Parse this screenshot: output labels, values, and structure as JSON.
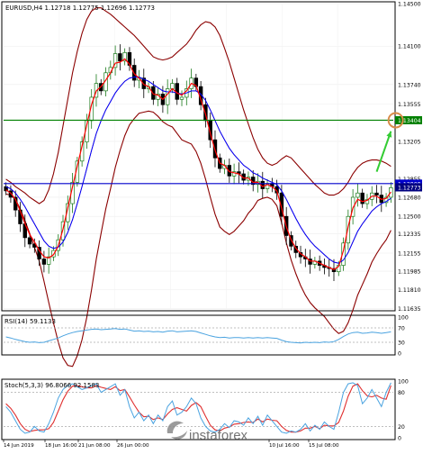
{
  "header": {
    "title": "EURUSD,H4  1.12718 1.12775 1.12696 1.12773"
  },
  "colors": {
    "background": "#ffffff",
    "candle_up": "#1a7a1a",
    "candle_down": "#000000",
    "bollinger": "#8b0000",
    "ma_fast": "#ff0000",
    "ma_slow": "#0000ff",
    "green_line": "#008000",
    "blue_line": "#0000cc",
    "arrow": "#33cc33",
    "target_circle": "#d98c4a",
    "rsi_line": "#4aa3e0",
    "stoch_main": "#4aa3e0",
    "stoch_signal": "#e03030",
    "dotted_level": "#aaaaaa",
    "watermark_text": "#666666"
  },
  "chart_data": [
    {
      "type": "candlestick",
      "symbol": "EURUSD",
      "timeframe": "H4",
      "title": "EURUSD,H4  1.12718 1.12775 1.12696 1.12773",
      "ylim": [
        1.1163,
        1.145
      ],
      "y_ticks": [
        "1.14500",
        "1.14100",
        "1.13740",
        "1.13555",
        "1.13205",
        "1.12855",
        "1.12680",
        "1.12500",
        "1.12335",
        "1.12155",
        "1.11985",
        "1.11810",
        "1.11635"
      ],
      "x_ticks": [
        "14 Jun 2019",
        "18 Jun 16:00",
        "21 Jun 08:00",
        "26 Jun 00:00",
        "10 Jul 16:00",
        "15 Jul 08:00"
      ],
      "horizontal_lines": [
        {
          "price": 1.13404,
          "label": "1.13404",
          "color": "#008000"
        },
        {
          "price": 1.12808,
          "label": "1.12808",
          "color": "#0000cc"
        }
      ],
      "current_price_label": "1.12773",
      "target": {
        "bar": 82,
        "price": 1.13404
      },
      "arrow": {
        "from_bar": 78,
        "from_price": 1.1292,
        "to_bar": 81,
        "to_price": 1.133
      },
      "close": [
        1.1274,
        1.1268,
        1.1256,
        1.1243,
        1.123,
        1.1224,
        1.1221,
        1.121,
        1.1205,
        1.1212,
        1.1218,
        1.1228,
        1.1245,
        1.1262,
        1.1282,
        1.1302,
        1.132,
        1.134,
        1.1362,
        1.1375,
        1.1368,
        1.1385,
        1.139,
        1.1403,
        1.1396,
        1.1404,
        1.1392,
        1.1378,
        1.138,
        1.137,
        1.1372,
        1.136,
        1.1365,
        1.1355,
        1.137,
        1.1375,
        1.136,
        1.1362,
        1.137,
        1.138,
        1.1372,
        1.1355,
        1.134,
        1.1322,
        1.1305,
        1.1295,
        1.1298,
        1.1288,
        1.1292,
        1.129,
        1.1284,
        1.1287,
        1.128,
        1.1283,
        1.1276,
        1.1281,
        1.1278,
        1.1272,
        1.125,
        1.1232,
        1.1222,
        1.1216,
        1.1212,
        1.121,
        1.1205,
        1.1208,
        1.1204,
        1.1202,
        1.1201,
        1.1198,
        1.1204,
        1.1225,
        1.125,
        1.1268,
        1.1272,
        1.1262,
        1.1266,
        1.1272,
        1.127,
        1.1263,
        1.1268,
        1.1277
      ],
      "bollinger_upper": [
        1.1285,
        1.1282,
        1.1278,
        1.1275,
        1.1272,
        1.1268,
        1.1265,
        1.1262,
        1.1265,
        1.1275,
        1.129,
        1.131,
        1.1335,
        1.136,
        1.1385,
        1.1405,
        1.1422,
        1.1435,
        1.1443,
        1.1446,
        1.1446,
        1.1443,
        1.144,
        1.1436,
        1.1432,
        1.1428,
        1.1424,
        1.142,
        1.1415,
        1.141,
        1.1405,
        1.14,
        1.1398,
        1.1397,
        1.1398,
        1.14,
        1.1404,
        1.1408,
        1.1412,
        1.1418,
        1.1425,
        1.143,
        1.1433,
        1.1432,
        1.1428,
        1.142,
        1.1408,
        1.1395,
        1.138,
        1.1365,
        1.135,
        1.1337,
        1.1324,
        1.1313,
        1.1305,
        1.13,
        1.1298,
        1.13,
        1.1304,
        1.1307,
        1.1305,
        1.13,
        1.1295,
        1.129,
        1.1285,
        1.128,
        1.1276,
        1.1272,
        1.127,
        1.127,
        1.1272,
        1.1276,
        1.1282,
        1.129,
        1.1296,
        1.13,
        1.1302,
        1.1303,
        1.1303,
        1.1302,
        1.13,
        1.1297
      ],
      "ma_fast": [
        1.1275,
        1.1272,
        1.1266,
        1.1255,
        1.1243,
        1.1233,
        1.1226,
        1.1218,
        1.1212,
        1.1211,
        1.1214,
        1.1222,
        1.1238,
        1.1258,
        1.1278,
        1.1297,
        1.1316,
        1.1336,
        1.1355,
        1.1368,
        1.1372,
        1.1378,
        1.1385,
        1.1394,
        1.1395,
        1.1398,
        1.1393,
        1.1384,
        1.138,
        1.1374,
        1.1372,
        1.1365,
        1.1364,
        1.136,
        1.1365,
        1.137,
        1.1366,
        1.1364,
        1.1368,
        1.1375,
        1.1373,
        1.136,
        1.1346,
        1.1328,
        1.1312,
        1.13,
        1.1298,
        1.1292,
        1.1291,
        1.129,
        1.1286,
        1.1286,
        1.1282,
        1.1282,
        1.1278,
        1.128,
        1.1278,
        1.1274,
        1.1258,
        1.124,
        1.1228,
        1.122,
        1.1215,
        1.1212,
        1.1208,
        1.1208,
        1.1206,
        1.1204,
        1.1202,
        1.12,
        1.1203,
        1.1218,
        1.124,
        1.1258,
        1.1266,
        1.1264,
        1.1265,
        1.1269,
        1.1269,
        1.1266,
        1.1267,
        1.1273
      ],
      "ma_slow": [
        1.1278,
        1.1276,
        1.1272,
        1.1266,
        1.1259,
        1.1251,
        1.1243,
        1.1235,
        1.1227,
        1.1222,
        1.122,
        1.1221,
        1.1226,
        1.1235,
        1.1247,
        1.1262,
        1.1278,
        1.1295,
        1.1312,
        1.1328,
        1.134,
        1.135,
        1.1358,
        1.1366,
        1.1372,
        1.1377,
        1.138,
        1.1381,
        1.1381,
        1.1379,
        1.1377,
        1.1374,
        1.1371,
        1.1368,
        1.1367,
        1.1367,
        1.1366,
        1.1365,
        1.1366,
        1.1368,
        1.1368,
        1.1365,
        1.1359,
        1.135,
        1.134,
        1.133,
        1.1322,
        1.1314,
        1.1308,
        1.1303,
        1.1298,
        1.1295,
        1.1291,
        1.1289,
        1.1286,
        1.1284,
        1.1282,
        1.128,
        1.1274,
        1.1266,
        1.1257,
        1.1248,
        1.124,
        1.1233,
        1.1227,
        1.1222,
        1.1218,
        1.1214,
        1.121,
        1.1207,
        1.1206,
        1.1209,
        1.1216,
        1.1226,
        1.1236,
        1.1243,
        1.1249,
        1.1255,
        1.1259,
        1.1262,
        1.1264,
        1.1267
      ]
    },
    {
      "type": "line",
      "name": "RSI(14) 59.1133",
      "title": "RSI(14) 59.1133",
      "ylim": [
        0,
        100
      ],
      "y_ticks": [
        "100",
        "70",
        "30",
        "0"
      ],
      "levels": [
        70,
        30
      ],
      "values": [
        45,
        42,
        38,
        35,
        32,
        30,
        31,
        29,
        30,
        34,
        38,
        42,
        48,
        53,
        57,
        60,
        62,
        64,
        66,
        67,
        65,
        66,
        67,
        68,
        66,
        67,
        64,
        61,
        62,
        60,
        61,
        59,
        60,
        58,
        61,
        62,
        59,
        60,
        61,
        62,
        60,
        56,
        52,
        48,
        45,
        43,
        44,
        42,
        43,
        43,
        42,
        43,
        42,
        43,
        42,
        43,
        42,
        41,
        36,
        32,
        30,
        29,
        28,
        30,
        29,
        30,
        29,
        31,
        30,
        32,
        38,
        46,
        53,
        57,
        58,
        55,
        56,
        58,
        57,
        55,
        57,
        59
      ]
    },
    {
      "type": "line",
      "name": "Stoch(5,3,3) 96.8066 92.1583",
      "title": "Stoch(5,3,3) 96.8066 92.1583",
      "ylim": [
        0,
        100
      ],
      "y_ticks": [
        "100",
        "80",
        "20",
        "0"
      ],
      "levels": [
        80,
        20
      ],
      "series": [
        {
          "name": "main",
          "values": [
            55,
            45,
            30,
            15,
            8,
            10,
            20,
            12,
            10,
            25,
            45,
            70,
            85,
            92,
            95,
            90,
            85,
            88,
            92,
            95,
            80,
            85,
            90,
            95,
            75,
            85,
            55,
            35,
            45,
            30,
            40,
            25,
            40,
            30,
            55,
            65,
            40,
            45,
            55,
            70,
            60,
            35,
            20,
            12,
            10,
            15,
            25,
            18,
            30,
            28,
            22,
            35,
            25,
            38,
            22,
            40,
            30,
            20,
            10,
            8,
            12,
            10,
            15,
            25,
            12,
            22,
            15,
            28,
            20,
            15,
            45,
            80,
            95,
            97,
            92,
            60,
            70,
            85,
            70,
            55,
            80,
            97
          ]
        },
        {
          "name": "signal",
          "values": [
            60,
            52,
            40,
            25,
            15,
            11,
            13,
            14,
            14,
            16,
            27,
            47,
            67,
            82,
            91,
            92,
            90,
            88,
            88,
            92,
            89,
            87,
            85,
            90,
            83,
            85,
            72,
            58,
            45,
            37,
            38,
            32,
            35,
            32,
            42,
            50,
            53,
            50,
            47,
            57,
            62,
            55,
            38,
            22,
            14,
            12,
            17,
            19,
            24,
            25,
            27,
            28,
            27,
            33,
            28,
            33,
            31,
            30,
            20,
            13,
            10,
            10,
            12,
            17,
            17,
            20,
            16,
            22,
            21,
            21,
            27,
            47,
            73,
            91,
            95,
            83,
            74,
            72,
            75,
            70,
            68,
            92
          ]
        }
      ]
    }
  ],
  "panels": {
    "rsi_label": "RSI(14) 59.1133",
    "stoch_label": "Stoch(5,3,3) 96.8066 92.1583"
  },
  "watermark": {
    "text": "instaforex",
    "icon": "instaforex-logo-icon"
  }
}
